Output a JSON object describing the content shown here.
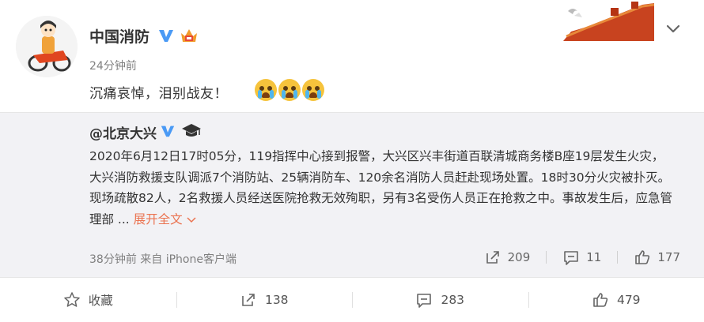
{
  "post": {
    "username": "中国消防",
    "time": "24分钟前",
    "text": "沉痛哀悼，泪别战友！",
    "emojis": [
      "crying-face",
      "crying-face",
      "crying-face"
    ]
  },
  "repost": {
    "username": "@北京大兴",
    "text": "2020年6月12日17时05分，119指挥中心接到报警，大兴区兴丰街道百联清城商务楼B座19层发生火灾，大兴消防救援支队调派7个消防站、25辆消防车、120余名消防人员赶赴现场处置。18时30分火灾被扑灭。现场疏散82人，2名救援人员经送医院抢救无效殉职，另有3名受伤人员正在抢救之中。事故发生后，应急管理部 ...",
    "expand_label": "展开全文",
    "meta": "38分钟前 来自 iPhone客户端",
    "repost_count": "209",
    "comment_count": "11",
    "like_count": "177"
  },
  "actions": {
    "favorite_label": "收藏",
    "repost_count": "138",
    "comment_count": "283",
    "like_count": "479"
  },
  "colors": {
    "accent": "#eb7350",
    "verified": "#4a9af5",
    "repost_bg": "#f2f2f5"
  }
}
